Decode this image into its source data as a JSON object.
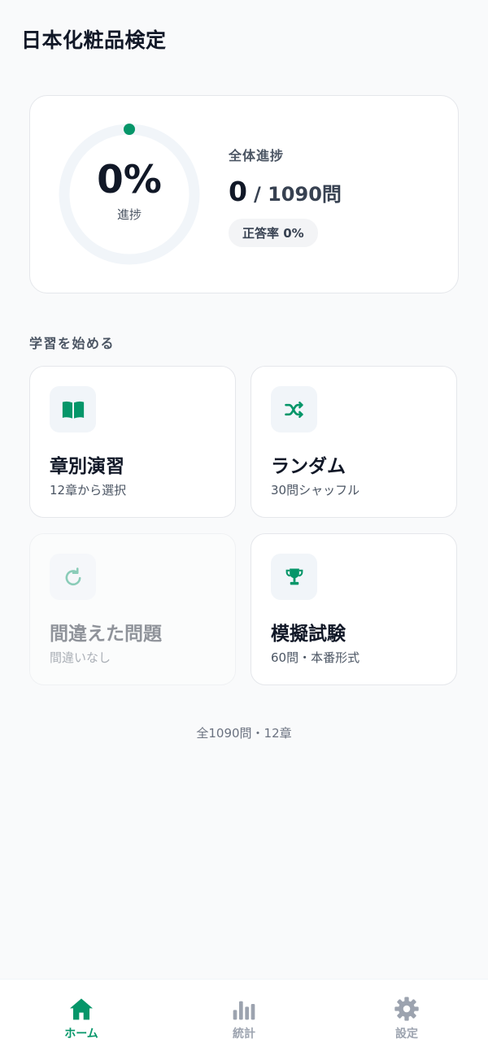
{
  "app": {
    "title": "日本化粧品検定"
  },
  "progress": {
    "percent_text": "0%",
    "percent_value": 0,
    "ring_label": "進捗",
    "overall_title": "全体進捗",
    "done": "0",
    "total": "/ 1090問",
    "accuracy": "正答率 0%"
  },
  "start_section": {
    "title": "学習を始める",
    "modes": [
      {
        "icon": "book-icon",
        "title": "章別演習",
        "subtitle": "12章から選択",
        "enabled": true
      },
      {
        "icon": "shuffle-icon",
        "title": "ランダム",
        "subtitle": "30問シャッフル",
        "enabled": true
      },
      {
        "icon": "retry-icon",
        "title": "間違えた問題",
        "subtitle": "間違いなし",
        "enabled": false
      },
      {
        "icon": "trophy-icon",
        "title": "模擬試験",
        "subtitle": "60問・本番形式",
        "enabled": true
      }
    ]
  },
  "footer_note": "全1090問・12章",
  "bottom_nav": [
    {
      "icon": "home-icon",
      "label": "ホーム",
      "active": true
    },
    {
      "icon": "bar-chart-icon",
      "label": "統計",
      "active": false
    },
    {
      "icon": "gear-icon",
      "label": "設定",
      "active": false
    }
  ],
  "colors": {
    "accent": "#059669",
    "ring_track": "#f1f5f9",
    "text_primary": "#111827",
    "text_secondary": "#4b5563",
    "nav_inactive": "#9ca3af"
  }
}
